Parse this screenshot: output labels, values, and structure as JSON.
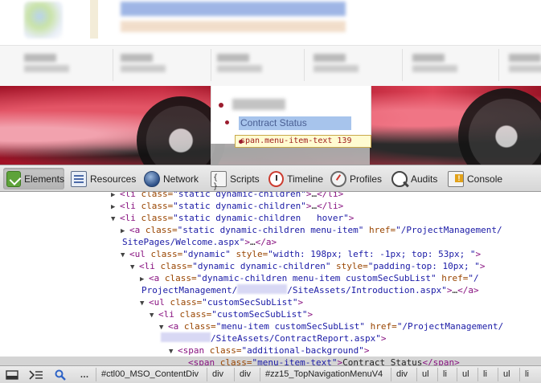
{
  "webpage": {
    "dropdown": {
      "hovered_item": "Contract Status"
    },
    "tooltip": "span.menu-item-text 139"
  },
  "devtools": {
    "tabs": [
      {
        "label": "Elements",
        "icon": "elements-icon",
        "active": true
      },
      {
        "label": "Resources",
        "icon": "resources-icon"
      },
      {
        "label": "Network",
        "icon": "network-icon"
      },
      {
        "label": "Scripts",
        "icon": "scripts-icon"
      },
      {
        "label": "Timeline",
        "icon": "timeline-icon"
      },
      {
        "label": "Profiles",
        "icon": "profiles-icon"
      },
      {
        "label": "Audits",
        "icon": "audits-icon"
      },
      {
        "label": "Console",
        "icon": "console-icon"
      }
    ],
    "dom_lines": [
      {
        "indent": 0,
        "tri": "▶",
        "parts": [
          [
            "tag",
            "<li "
          ],
          [
            "attr",
            "class="
          ],
          [
            "val",
            "\"static dynamic-children\""
          ],
          [
            "tag",
            ">"
          ],
          [
            "text",
            "…"
          ],
          [
            "tag",
            "</li>"
          ]
        ]
      },
      {
        "indent": 0,
        "tri": "▶",
        "parts": [
          [
            "tag",
            "<li "
          ],
          [
            "attr",
            "class="
          ],
          [
            "val",
            "\"static dynamic-children\""
          ],
          [
            "tag",
            ">"
          ],
          [
            "text",
            "…"
          ],
          [
            "tag",
            "</li>"
          ]
        ]
      },
      {
        "indent": 0,
        "tri": "▼",
        "parts": [
          [
            "tag",
            "<li "
          ],
          [
            "attr",
            "class="
          ],
          [
            "val",
            "\"static dynamic-children   hover\""
          ],
          [
            "tag",
            ">"
          ]
        ]
      },
      {
        "indent": 1,
        "tri": "▶",
        "parts": [
          [
            "tag",
            "<a "
          ],
          [
            "attr",
            "class="
          ],
          [
            "val",
            "\"static dynamic-children menu-item\""
          ],
          [
            "attr",
            " href="
          ],
          [
            "val",
            "\"/ProjectManagement/"
          ]
        ]
      },
      {
        "indent": 1,
        "tri": "",
        "parts": [
          [
            "val",
            "SitePages/Welcome.aspx\""
          ],
          [
            "tag",
            ">"
          ],
          [
            "text",
            "…"
          ],
          [
            "tag",
            "</a>"
          ]
        ]
      },
      {
        "indent": 1,
        "tri": "▼",
        "parts": [
          [
            "tag",
            "<ul "
          ],
          [
            "attr",
            "class="
          ],
          [
            "val",
            "\"dynamic\""
          ],
          [
            "attr",
            " style="
          ],
          [
            "val",
            "\"width: 198px; left: -1px; top: 53px; \""
          ],
          [
            "tag",
            ">"
          ]
        ]
      },
      {
        "indent": 2,
        "tri": "▼",
        "parts": [
          [
            "tag",
            "<li "
          ],
          [
            "attr",
            "class="
          ],
          [
            "val",
            "\"dynamic dynamic-children\""
          ],
          [
            "attr",
            " style="
          ],
          [
            "val",
            "\"padding-top: 10px; \""
          ],
          [
            "tag",
            ">"
          ]
        ]
      },
      {
        "indent": 3,
        "tri": "▶",
        "parts": [
          [
            "tag",
            "<a "
          ],
          [
            "attr",
            "class="
          ],
          [
            "val",
            "\"dynamic-children menu-item customSecSubList\""
          ],
          [
            "attr",
            " href="
          ],
          [
            "val",
            "\"/"
          ]
        ]
      },
      {
        "indent": 3,
        "tri": "",
        "parts": [
          [
            "val",
            "ProjectManagement/"
          ],
          [
            "redact",
            ""
          ],
          [
            "val",
            "/SiteAssets/Introduction.aspx\""
          ],
          [
            "tag",
            ">"
          ],
          [
            "text",
            "…"
          ],
          [
            "tag",
            "</a>"
          ]
        ]
      },
      {
        "indent": 3,
        "tri": "▼",
        "parts": [
          [
            "tag",
            "<ul "
          ],
          [
            "attr",
            "class="
          ],
          [
            "val",
            "\"customSecSubList\""
          ],
          [
            "tag",
            ">"
          ]
        ]
      },
      {
        "indent": 4,
        "tri": "▼",
        "parts": [
          [
            "tag",
            "<li "
          ],
          [
            "attr",
            "class="
          ],
          [
            "val",
            "\"customSecSubList\""
          ],
          [
            "tag",
            ">"
          ]
        ]
      },
      {
        "indent": 5,
        "tri": "▼",
        "parts": [
          [
            "tag",
            "<a "
          ],
          [
            "attr",
            "class="
          ],
          [
            "val",
            "\"menu-item customSecSubList\""
          ],
          [
            "attr",
            " href="
          ],
          [
            "val",
            "\"/ProjectManagement/"
          ]
        ]
      },
      {
        "indent": 5,
        "tri": "",
        "parts": [
          [
            "redact",
            ""
          ],
          [
            "val",
            "/SiteAssets/ContractReport.aspx\""
          ],
          [
            "tag",
            ">"
          ]
        ]
      },
      {
        "indent": 6,
        "tri": "▼",
        "parts": [
          [
            "tag",
            "<span "
          ],
          [
            "attr",
            "class="
          ],
          [
            "val",
            "\"additional-background\""
          ],
          [
            "tag",
            ">"
          ]
        ]
      },
      {
        "indent": 7,
        "tri": "",
        "selected": true,
        "parts": [
          [
            "tag",
            "<span "
          ],
          [
            "attr",
            "class="
          ],
          [
            "val",
            "\"menu-item-text\""
          ],
          [
            "tag",
            ">"
          ],
          [
            "text",
            "Contract Status"
          ],
          [
            "tag",
            "</span>"
          ]
        ]
      }
    ],
    "statusbar": {
      "breadcrumbs": [
        "#ctl00_MSO_ContentDiv",
        "div",
        "div",
        "#zz15_TopNavigationMenuV4",
        "div",
        "ul",
        "li",
        "ul",
        "li",
        "ul",
        "li"
      ]
    }
  }
}
